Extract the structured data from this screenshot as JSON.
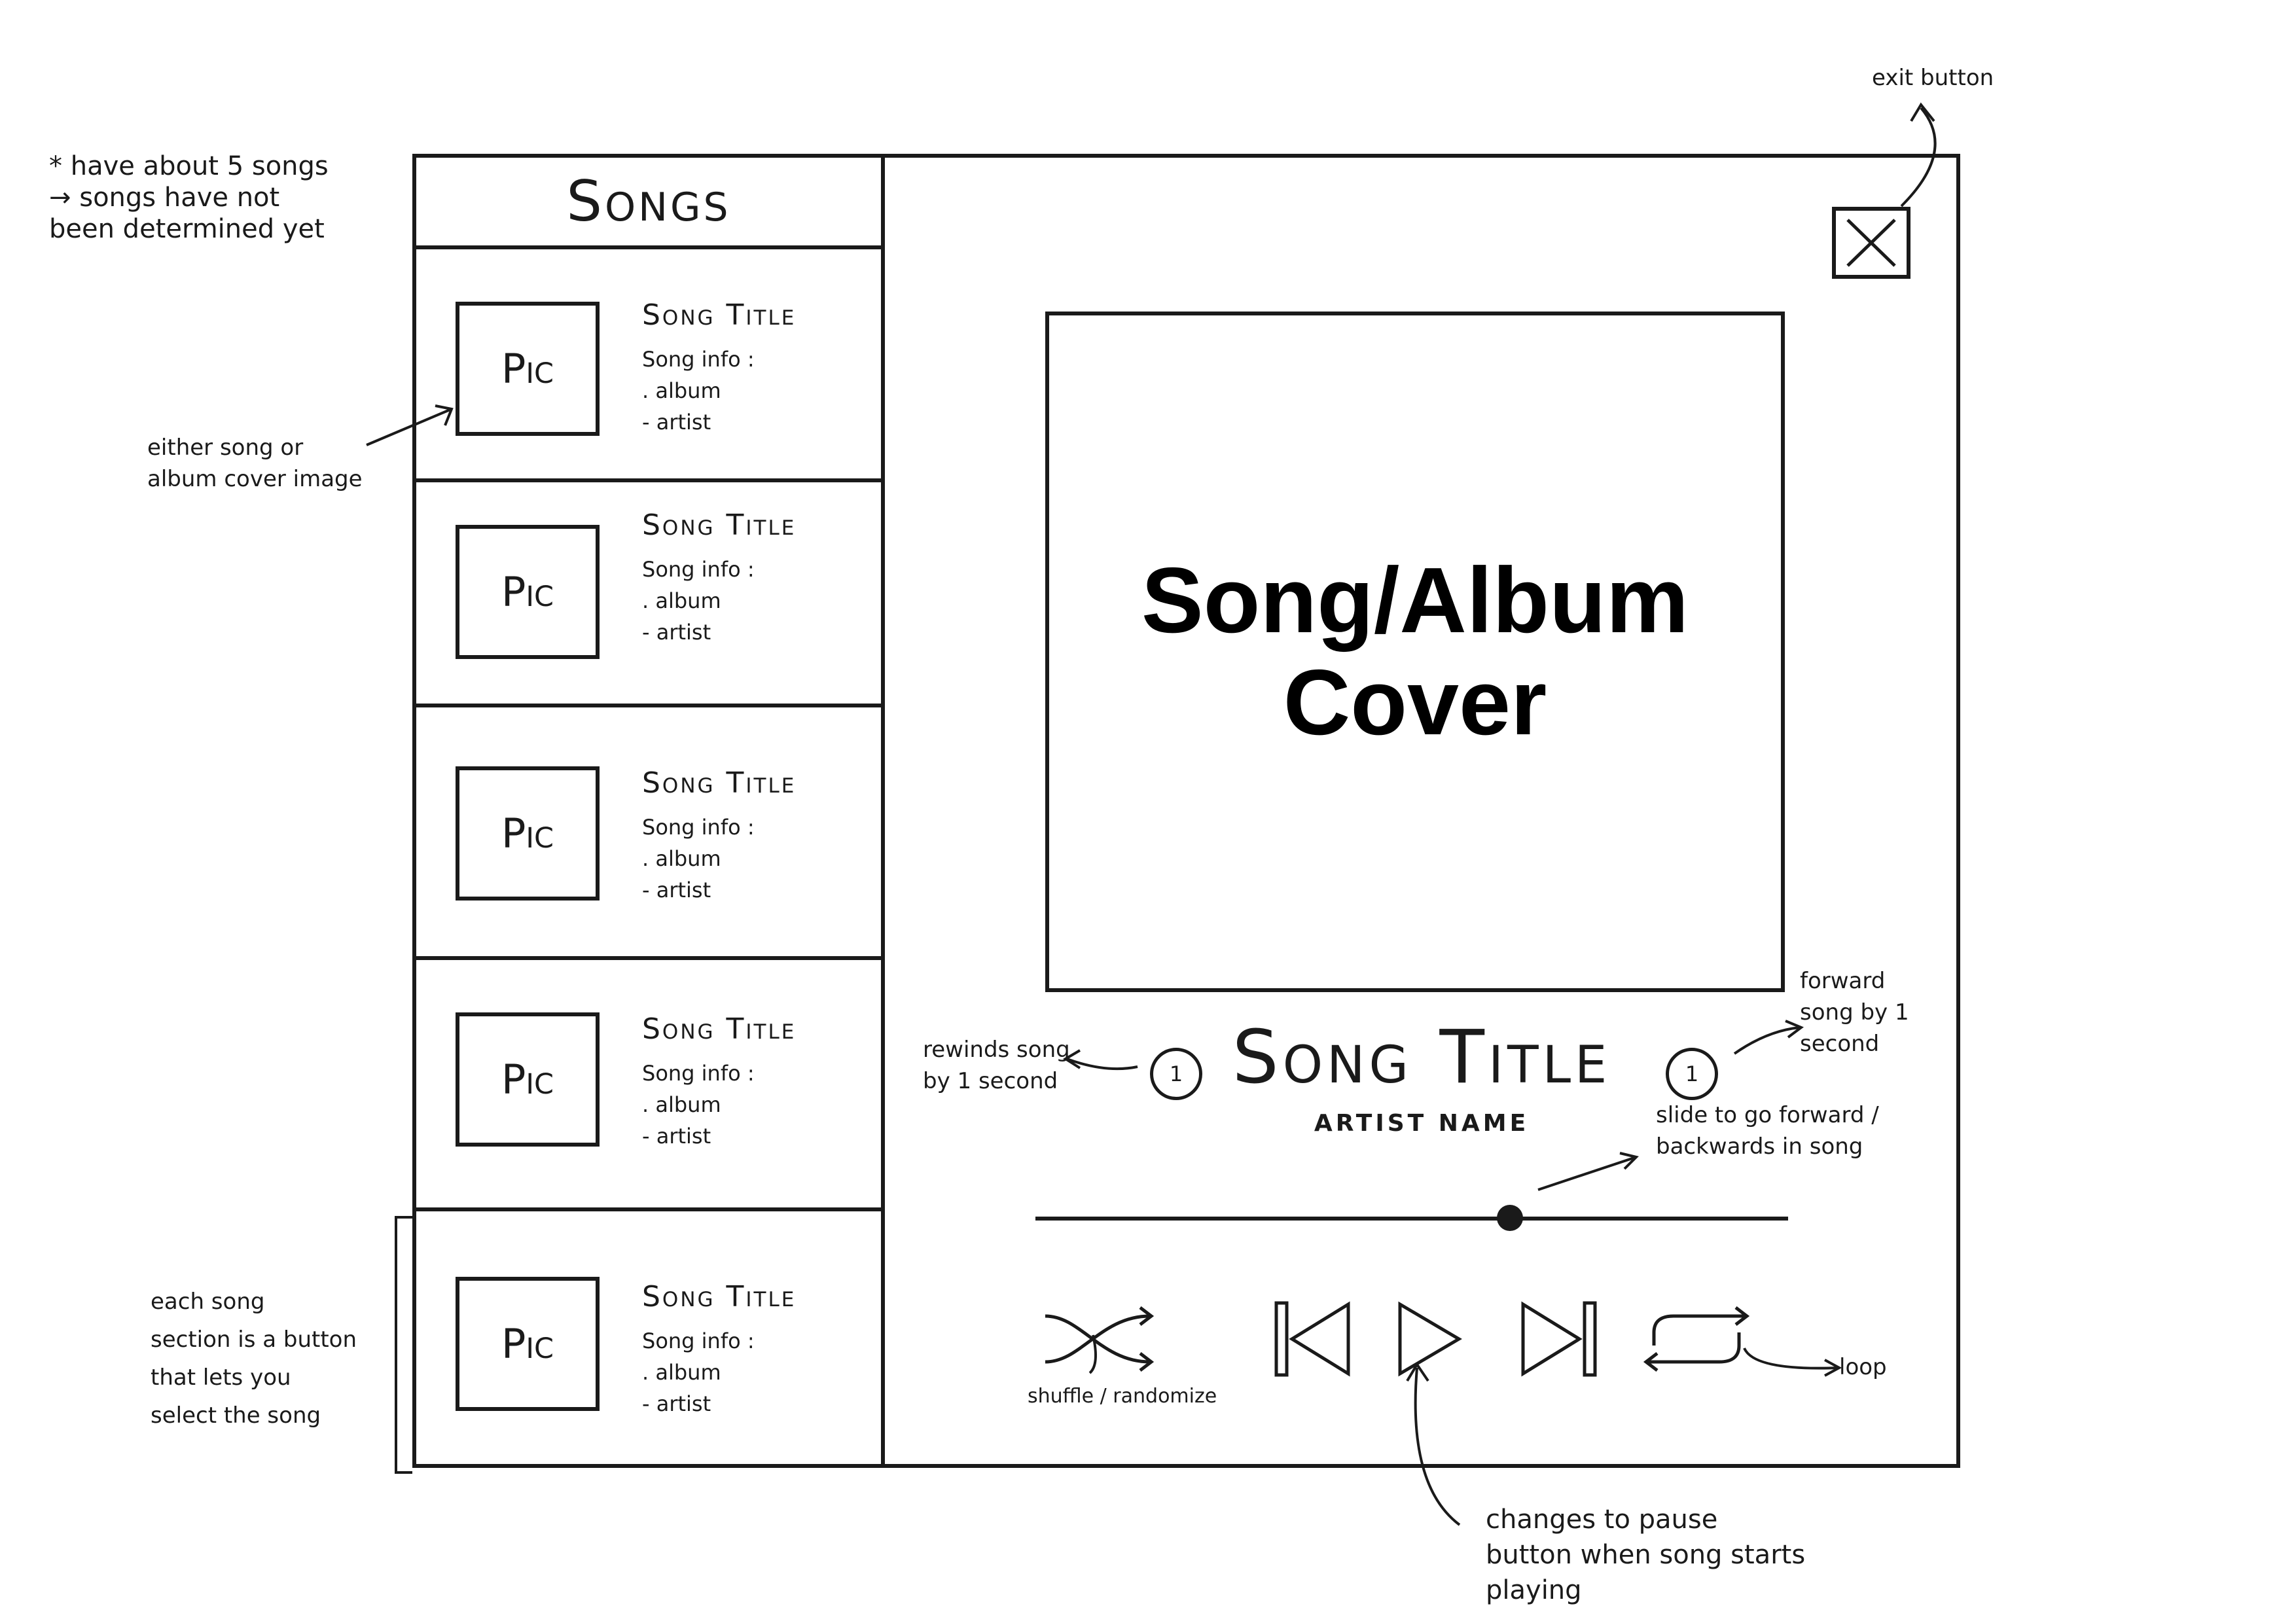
{
  "songs_panel": {
    "header": "Songs",
    "items": [
      {
        "pic": "Pic",
        "title": "Song Title",
        "info_label": "Song info :",
        "album": ". album",
        "artist": "- artist"
      },
      {
        "pic": "Pic",
        "title": "Song Title",
        "info_label": "Song info :",
        "album": ". album",
        "artist": "- artist"
      },
      {
        "pic": "Pic",
        "title": "Song Title",
        "info_label": "Song info :",
        "album": ". album",
        "artist": "- artist"
      },
      {
        "pic": "Pic",
        "title": "Song Title",
        "info_label": "Song info :",
        "album": ". album",
        "artist": "- artist"
      },
      {
        "pic": "Pic",
        "title": "Song Title",
        "info_label": "Song info :",
        "album": ". album",
        "artist": "- artist"
      }
    ]
  },
  "player": {
    "cover_text": "Song/Album\nCover",
    "song_title": "Song Title",
    "artist_name": "ARTIST NAME",
    "rewind_label": "1",
    "forward_label": "1",
    "progress": 0.63,
    "icons": {
      "exit": "close-icon",
      "shuffle": "shuffle-icon",
      "previous": "skip-previous-icon",
      "play": "play-icon",
      "next": "skip-next-icon",
      "loop": "loop-icon"
    }
  },
  "annotations": {
    "five_songs": "* have about 5 songs\n→ songs have not\n   been determined yet",
    "cover_image": "either song or\nalbum cover image",
    "song_button": "each song\nsection is a button\nthat lets you\nselect the song",
    "exit": "exit button",
    "rewind": "rewinds song\nby 1 second",
    "forward": "forward\nsong by 1\nsecond",
    "slider": "slide to go forward /\nbackwards in song",
    "shuffle": "shuffle / randomize",
    "loop": "loop",
    "pause": "changes to pause\nbutton when song starts\nplaying"
  }
}
